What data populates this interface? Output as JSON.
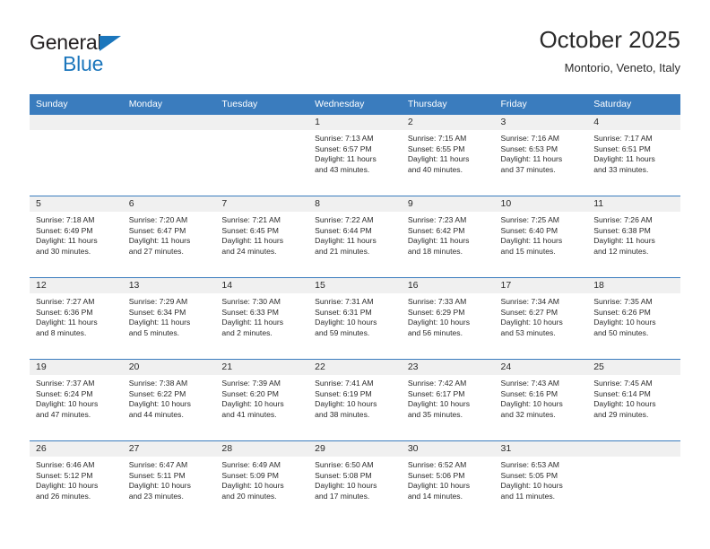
{
  "brand": {
    "name_top": "General",
    "name_bottom": "Blue",
    "accent_color": "#1b76bc"
  },
  "header": {
    "title": "October 2025",
    "subtitle": "Montorio, Veneto, Italy"
  },
  "theme": {
    "header_blue": "#3a7cbe",
    "day_band_gray": "#f0f0f0",
    "text": "#2a2a2a"
  },
  "labels": {
    "sunrise_prefix": "Sunrise:",
    "sunset_prefix": "Sunset:",
    "daylight_prefix": "Daylight:"
  },
  "weekday_headers": [
    "Sunday",
    "Monday",
    "Tuesday",
    "Wednesday",
    "Thursday",
    "Friday",
    "Saturday"
  ],
  "weeks": [
    [
      {
        "day": "",
        "empty": true
      },
      {
        "day": "",
        "empty": true
      },
      {
        "day": "",
        "empty": true
      },
      {
        "day": "1",
        "sunrise": "Sunrise: 7:13 AM",
        "sunset": "Sunset: 6:57 PM",
        "daylight_line1": "Daylight: 11 hours",
        "daylight_line2": "and 43 minutes."
      },
      {
        "day": "2",
        "sunrise": "Sunrise: 7:15 AM",
        "sunset": "Sunset: 6:55 PM",
        "daylight_line1": "Daylight: 11 hours",
        "daylight_line2": "and 40 minutes."
      },
      {
        "day": "3",
        "sunrise": "Sunrise: 7:16 AM",
        "sunset": "Sunset: 6:53 PM",
        "daylight_line1": "Daylight: 11 hours",
        "daylight_line2": "and 37 minutes."
      },
      {
        "day": "4",
        "sunrise": "Sunrise: 7:17 AM",
        "sunset": "Sunset: 6:51 PM",
        "daylight_line1": "Daylight: 11 hours",
        "daylight_line2": "and 33 minutes."
      }
    ],
    [
      {
        "day": "5",
        "sunrise": "Sunrise: 7:18 AM",
        "sunset": "Sunset: 6:49 PM",
        "daylight_line1": "Daylight: 11 hours",
        "daylight_line2": "and 30 minutes."
      },
      {
        "day": "6",
        "sunrise": "Sunrise: 7:20 AM",
        "sunset": "Sunset: 6:47 PM",
        "daylight_line1": "Daylight: 11 hours",
        "daylight_line2": "and 27 minutes."
      },
      {
        "day": "7",
        "sunrise": "Sunrise: 7:21 AM",
        "sunset": "Sunset: 6:45 PM",
        "daylight_line1": "Daylight: 11 hours",
        "daylight_line2": "and 24 minutes."
      },
      {
        "day": "8",
        "sunrise": "Sunrise: 7:22 AM",
        "sunset": "Sunset: 6:44 PM",
        "daylight_line1": "Daylight: 11 hours",
        "daylight_line2": "and 21 minutes."
      },
      {
        "day": "9",
        "sunrise": "Sunrise: 7:23 AM",
        "sunset": "Sunset: 6:42 PM",
        "daylight_line1": "Daylight: 11 hours",
        "daylight_line2": "and 18 minutes."
      },
      {
        "day": "10",
        "sunrise": "Sunrise: 7:25 AM",
        "sunset": "Sunset: 6:40 PM",
        "daylight_line1": "Daylight: 11 hours",
        "daylight_line2": "and 15 minutes."
      },
      {
        "day": "11",
        "sunrise": "Sunrise: 7:26 AM",
        "sunset": "Sunset: 6:38 PM",
        "daylight_line1": "Daylight: 11 hours",
        "daylight_line2": "and 12 minutes."
      }
    ],
    [
      {
        "day": "12",
        "sunrise": "Sunrise: 7:27 AM",
        "sunset": "Sunset: 6:36 PM",
        "daylight_line1": "Daylight: 11 hours",
        "daylight_line2": "and 8 minutes."
      },
      {
        "day": "13",
        "sunrise": "Sunrise: 7:29 AM",
        "sunset": "Sunset: 6:34 PM",
        "daylight_line1": "Daylight: 11 hours",
        "daylight_line2": "and 5 minutes."
      },
      {
        "day": "14",
        "sunrise": "Sunrise: 7:30 AM",
        "sunset": "Sunset: 6:33 PM",
        "daylight_line1": "Daylight: 11 hours",
        "daylight_line2": "and 2 minutes."
      },
      {
        "day": "15",
        "sunrise": "Sunrise: 7:31 AM",
        "sunset": "Sunset: 6:31 PM",
        "daylight_line1": "Daylight: 10 hours",
        "daylight_line2": "and 59 minutes."
      },
      {
        "day": "16",
        "sunrise": "Sunrise: 7:33 AM",
        "sunset": "Sunset: 6:29 PM",
        "daylight_line1": "Daylight: 10 hours",
        "daylight_line2": "and 56 minutes."
      },
      {
        "day": "17",
        "sunrise": "Sunrise: 7:34 AM",
        "sunset": "Sunset: 6:27 PM",
        "daylight_line1": "Daylight: 10 hours",
        "daylight_line2": "and 53 minutes."
      },
      {
        "day": "18",
        "sunrise": "Sunrise: 7:35 AM",
        "sunset": "Sunset: 6:26 PM",
        "daylight_line1": "Daylight: 10 hours",
        "daylight_line2": "and 50 minutes."
      }
    ],
    [
      {
        "day": "19",
        "sunrise": "Sunrise: 7:37 AM",
        "sunset": "Sunset: 6:24 PM",
        "daylight_line1": "Daylight: 10 hours",
        "daylight_line2": "and 47 minutes."
      },
      {
        "day": "20",
        "sunrise": "Sunrise: 7:38 AM",
        "sunset": "Sunset: 6:22 PM",
        "daylight_line1": "Daylight: 10 hours",
        "daylight_line2": "and 44 minutes."
      },
      {
        "day": "21",
        "sunrise": "Sunrise: 7:39 AM",
        "sunset": "Sunset: 6:20 PM",
        "daylight_line1": "Daylight: 10 hours",
        "daylight_line2": "and 41 minutes."
      },
      {
        "day": "22",
        "sunrise": "Sunrise: 7:41 AM",
        "sunset": "Sunset: 6:19 PM",
        "daylight_line1": "Daylight: 10 hours",
        "daylight_line2": "and 38 minutes."
      },
      {
        "day": "23",
        "sunrise": "Sunrise: 7:42 AM",
        "sunset": "Sunset: 6:17 PM",
        "daylight_line1": "Daylight: 10 hours",
        "daylight_line2": "and 35 minutes."
      },
      {
        "day": "24",
        "sunrise": "Sunrise: 7:43 AM",
        "sunset": "Sunset: 6:16 PM",
        "daylight_line1": "Daylight: 10 hours",
        "daylight_line2": "and 32 minutes."
      },
      {
        "day": "25",
        "sunrise": "Sunrise: 7:45 AM",
        "sunset": "Sunset: 6:14 PM",
        "daylight_line1": "Daylight: 10 hours",
        "daylight_line2": "and 29 minutes."
      }
    ],
    [
      {
        "day": "26",
        "sunrise": "Sunrise: 6:46 AM",
        "sunset": "Sunset: 5:12 PM",
        "daylight_line1": "Daylight: 10 hours",
        "daylight_line2": "and 26 minutes."
      },
      {
        "day": "27",
        "sunrise": "Sunrise: 6:47 AM",
        "sunset": "Sunset: 5:11 PM",
        "daylight_line1": "Daylight: 10 hours",
        "daylight_line2": "and 23 minutes."
      },
      {
        "day": "28",
        "sunrise": "Sunrise: 6:49 AM",
        "sunset": "Sunset: 5:09 PM",
        "daylight_line1": "Daylight: 10 hours",
        "daylight_line2": "and 20 minutes."
      },
      {
        "day": "29",
        "sunrise": "Sunrise: 6:50 AM",
        "sunset": "Sunset: 5:08 PM",
        "daylight_line1": "Daylight: 10 hours",
        "daylight_line2": "and 17 minutes."
      },
      {
        "day": "30",
        "sunrise": "Sunrise: 6:52 AM",
        "sunset": "Sunset: 5:06 PM",
        "daylight_line1": "Daylight: 10 hours",
        "daylight_line2": "and 14 minutes."
      },
      {
        "day": "31",
        "sunrise": "Sunrise: 6:53 AM",
        "sunset": "Sunset: 5:05 PM",
        "daylight_line1": "Daylight: 10 hours",
        "daylight_line2": "and 11 minutes."
      },
      {
        "day": "",
        "empty": true
      }
    ]
  ]
}
